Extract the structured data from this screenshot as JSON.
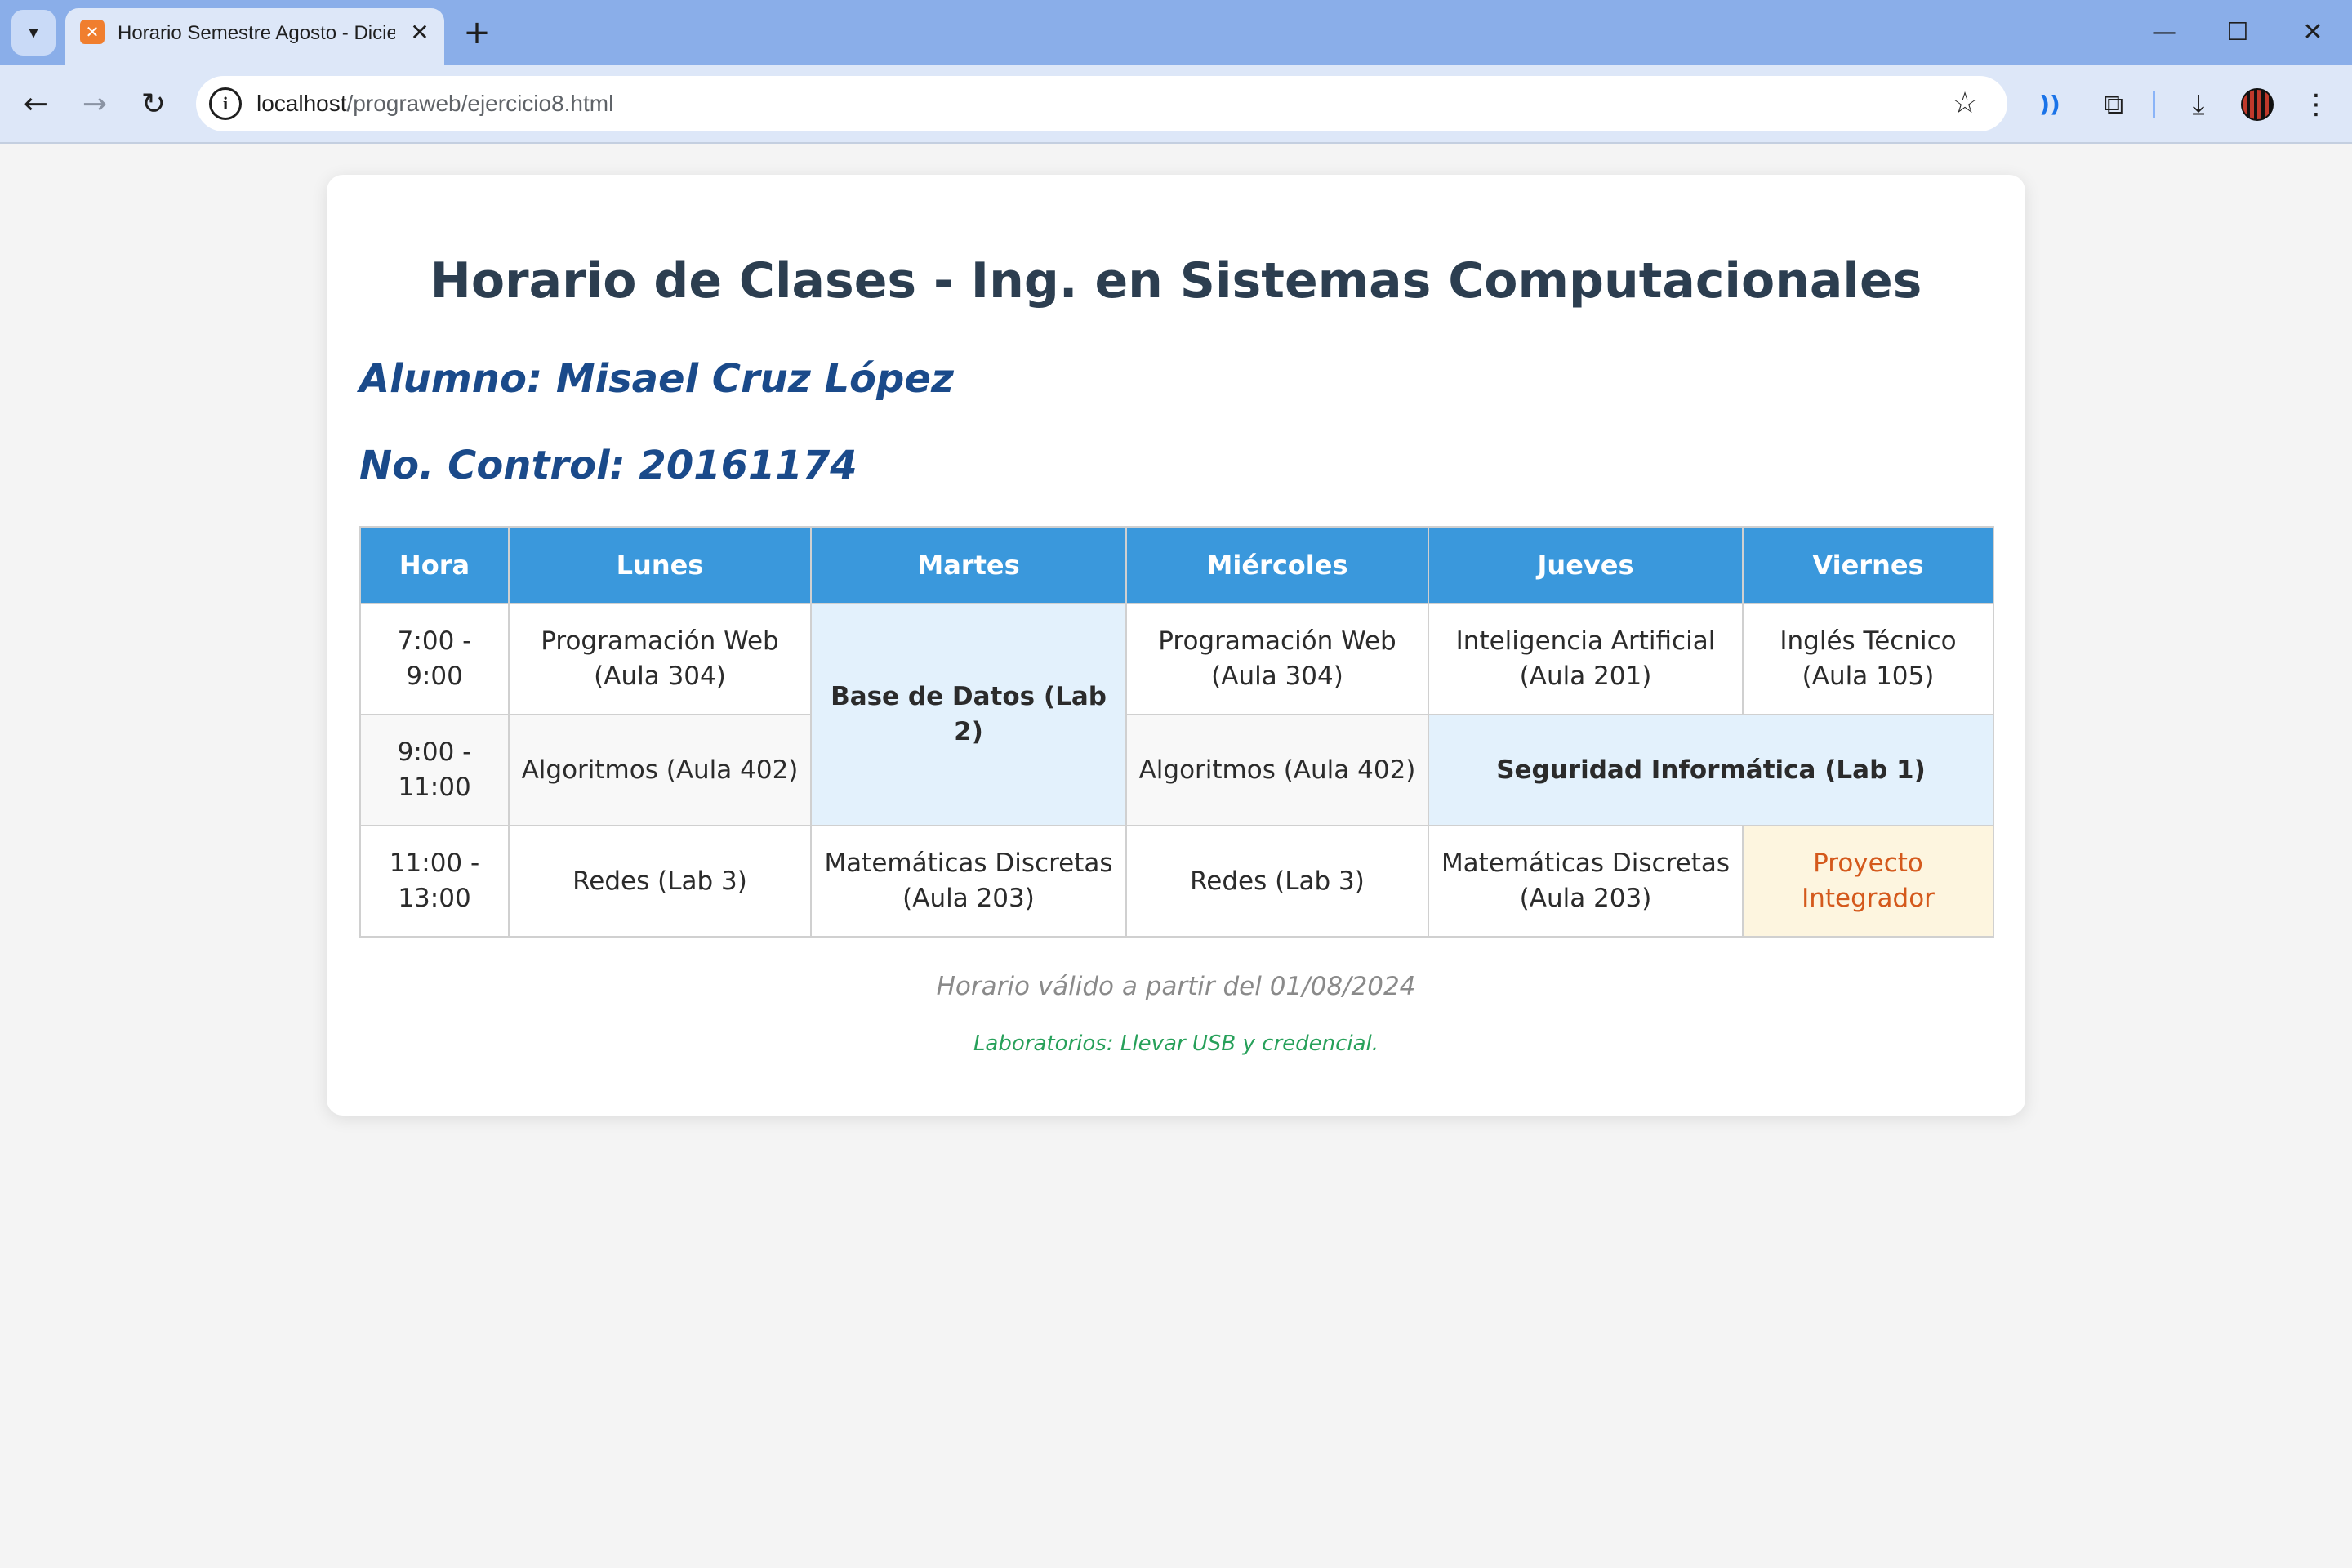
{
  "browser": {
    "tab_title": "Horario Semestre Agosto - Diciembre",
    "tab_favicon": "✕",
    "url_host": "localhost",
    "url_path": "/prograweb/ejercicio8.html",
    "icons": {
      "tab_search": "▾",
      "tab_close": "✕",
      "new_tab": "+",
      "minimize": "—",
      "maximize": "☐",
      "close": "✕",
      "back": "←",
      "forward": "→",
      "reload": "↻",
      "site_info": "i",
      "bookmark": "☆",
      "cast": "))",
      "extensions": "⧉",
      "download": "⤓",
      "menu": "⋮"
    }
  },
  "page": {
    "title": "Horario de Clases - Ing. en Sistemas Computacionales",
    "student_name": "Alumno: Misael Cruz López",
    "control_number": "No. Control: 20161174",
    "schedule": {
      "headers": [
        "Hora",
        "Lunes",
        "Martes",
        "Miércoles",
        "Jueves",
        "Viernes"
      ],
      "rows": [
        {
          "time": "7:00 - 9:00",
          "lunes": "Programación Web (Aula 304)",
          "martes": "Base de Datos (Lab 2)",
          "miercoles": "Programación Web (Aula 304)",
          "jueves": "Inteligencia Artificial (Aula 201)",
          "viernes": "Inglés Técnico (Aula 105)"
        },
        {
          "time": "9:00 - 11:00",
          "lunes": "Algoritmos (Aula 402)",
          "miercoles": "Algoritmos (Aula 402)",
          "jueves_viernes": "Seguridad Informática (Lab 1)"
        },
        {
          "time": "11:00 - 13:00",
          "lunes": "Redes (Lab 3)",
          "martes": "Matemáticas Discretas (Aula 203)",
          "miercoles": "Redes (Lab 3)",
          "jueves": "Matemáticas Discretas (Aula 203)",
          "viernes": "Proyecto Integrador"
        }
      ]
    },
    "valid_from": "Horario válido a partir del 01/08/2024",
    "lab_note": "Laboratorios: Llevar USB y credencial."
  },
  "colors": {
    "header_bg": "#3a98dc",
    "lab_bg": "#e3f1fc",
    "project_bg": "#fdf5df",
    "project_text": "#d4591c",
    "title_text": "#2c3e50",
    "student_text": "#1a4a8a",
    "note_green": "#27a05a"
  }
}
